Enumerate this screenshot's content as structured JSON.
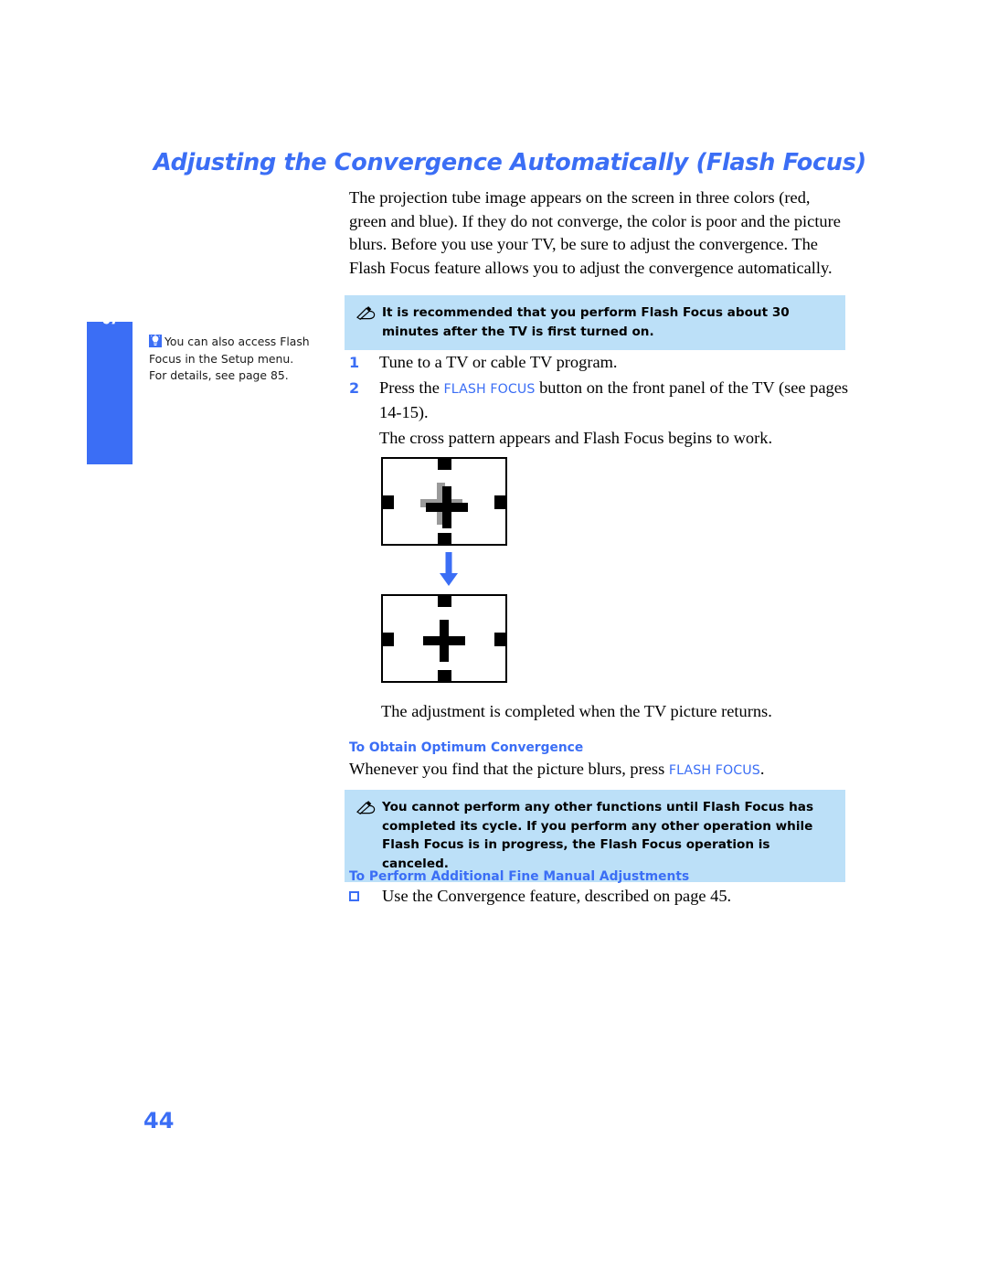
{
  "page": {
    "title": "Adjusting the Convergence Automatically (Flash Focus)",
    "number": "44"
  },
  "sidebar": {
    "tab_label": "Setup",
    "tip_icon": "lightbulb-icon",
    "tip_text": "You can also access Flash Focus in the Setup menu. For details, see page 85."
  },
  "intro": {
    "paragraph": "The projection tube image appears on the screen in three colors (red, green and blue). If they do not converge, the color is poor and the picture blurs. Before you use your TV, be sure to adjust the convergence. The Flash Focus feature allows you to adjust the convergence automatically."
  },
  "notes": [
    {
      "icon": "pencil-note-icon",
      "text": "It is recommended that you perform Flash Focus about 30 minutes after the TV is first turned on."
    },
    {
      "icon": "pencil-note-icon",
      "text": "You cannot perform any other functions until Flash Focus has completed its cycle. If you perform any other operation while Flash Focus is in progress, the Flash Focus operation is canceled."
    }
  ],
  "steps": [
    {
      "number": "1",
      "text_before": "Tune to a TV or cable TV program.",
      "button": "",
      "text_after": "",
      "sub": ""
    },
    {
      "number": "2",
      "text_before": "Press the ",
      "button": "FLASH FOCUS",
      "text_after": " button on the front panel of the TV (see pages 14-15).",
      "sub": "The cross pattern appears and Flash Focus begins to work."
    }
  ],
  "diagrams": {
    "arrow_icon": "arrow-down-icon",
    "top_caption": "",
    "bottom_caption": "The adjustment is completed when the TV picture returns."
  },
  "sections": [
    {
      "heading": "To Obtain Optimum Convergence",
      "body_before": "Whenever you find that the picture blurs, press ",
      "button": "FLASH FOCUS",
      "body_after": "."
    },
    {
      "heading": "To Perform Additional Fine Manual Adjustments",
      "bullet": "Use the Convergence feature, described on page 45."
    }
  ]
}
